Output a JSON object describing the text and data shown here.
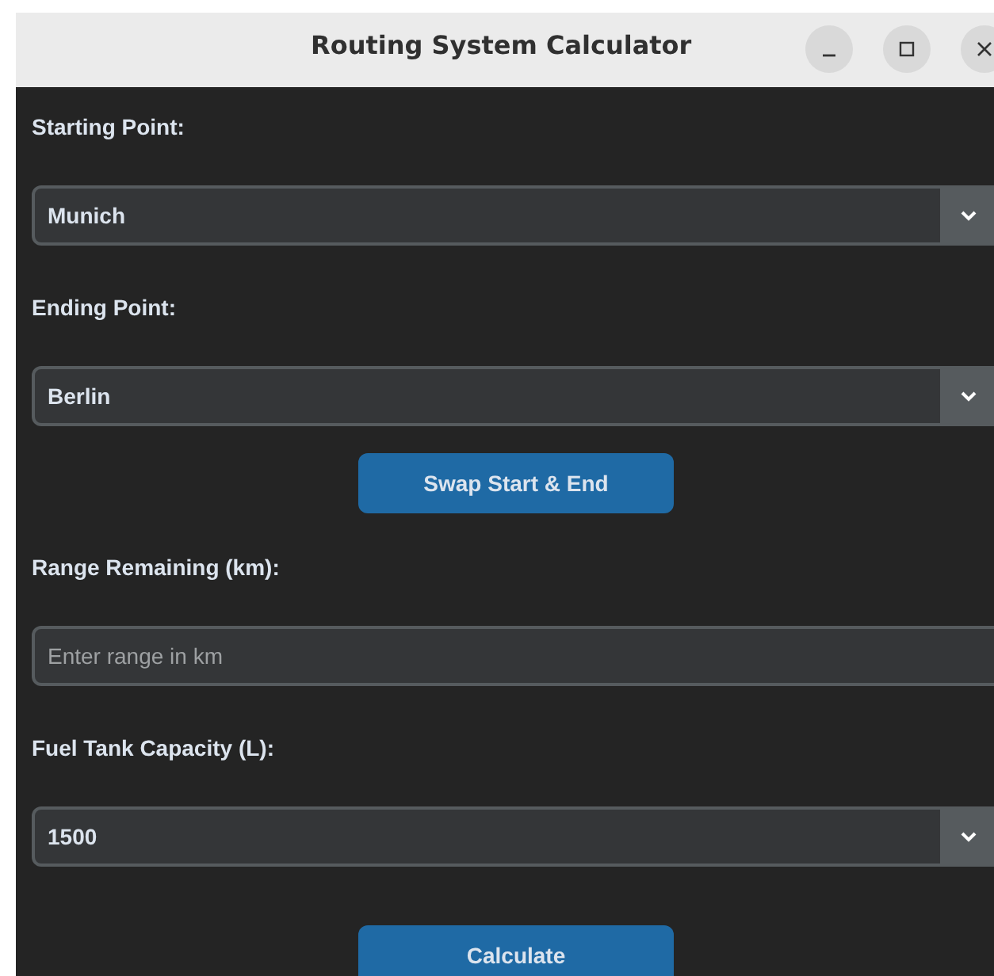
{
  "window": {
    "title": "Routing System Calculator"
  },
  "form": [
    {
      "kind": "label",
      "text": "Starting Point:"
    },
    {
      "kind": "combo",
      "value": "Munich"
    },
    {
      "kind": "label",
      "text": "Ending Point:"
    },
    {
      "kind": "combo",
      "value": "Berlin"
    },
    {
      "kind": "button",
      "text": "Swap Start & End"
    },
    {
      "kind": "label",
      "text": "Range Remaining (km):"
    },
    {
      "kind": "entry",
      "placeholder": "Enter range in km"
    },
    {
      "kind": "label",
      "text": "Fuel Tank Capacity (L):"
    },
    {
      "kind": "combo",
      "value": "1500"
    },
    {
      "kind": "button",
      "text": "Calculate"
    }
  ]
}
